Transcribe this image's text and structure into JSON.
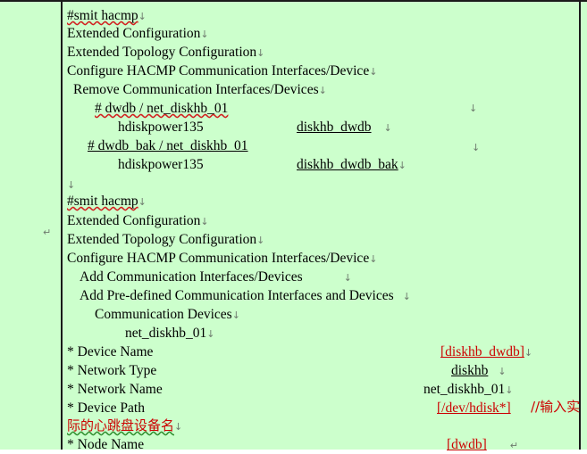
{
  "document": {
    "background_color": "#ccffcc",
    "text_color": "#000000",
    "accent_color": "#cc0000",
    "mark_color": "#6e7b6e",
    "spellcheck_underline_color": "#d21f1f",
    "grammar_underline_color": "#2f8f2f",
    "border_color": "#1a1a1a",
    "line_break_mark": "↓",
    "paragraph_mark": "↵"
  },
  "block_one": {
    "lines": [
      {
        "id": "l01",
        "text": "#smit hacmp",
        "mark": "↓"
      },
      {
        "id": "l02",
        "text": "Extended Configuration",
        "mark": "↓"
      },
      {
        "id": "l03",
        "text": "Extended Topology Configuration",
        "mark": "↓"
      },
      {
        "id": "l04",
        "text": "Configure HACMP Communication Interfaces/Device",
        "mark": "↓"
      },
      {
        "id": "l05",
        "text": "Remove Communication Interfaces/Devices",
        "mark": "↓"
      },
      {
        "id": "l06",
        "text": "# dwdb / net_diskhb_01",
        "mark": ""
      },
      {
        "id": "l07",
        "text": "hdiskpower135",
        "value": "diskhb_dwdb",
        "mark": "↓"
      },
      {
        "id": "l08",
        "text": "# dwdb_bak / net_diskhb_01",
        "mark": "↓"
      },
      {
        "id": "l09",
        "text": "hdiskpower135",
        "value": "diskhb_dwdb_bak",
        "mark": "↓"
      }
    ]
  },
  "block_two": {
    "lines": [
      {
        "id": "l11",
        "text": "#smit hacmp",
        "mark": "↓"
      },
      {
        "id": "l12",
        "text": "Extended Configuration",
        "mark": "↓"
      },
      {
        "id": "l13",
        "text": "Extended Topology Configuration",
        "mark": "↓"
      },
      {
        "id": "l14",
        "text": "Configure HACMP Communication Interfaces/Device",
        "mark": "↓"
      },
      {
        "id": "l15",
        "text": "Add Communication Interfaces/Devices",
        "mark": "↓"
      },
      {
        "id": "l16",
        "text": "Add Pre-defined Communication Interfaces and Devices",
        "mark": "↓"
      },
      {
        "id": "l17",
        "text": "Communication Devices",
        "mark": "↓"
      },
      {
        "id": "l18",
        "text": "net_diskhb_01",
        "mark": "↓"
      }
    ]
  },
  "fields": [
    {
      "id": "f1",
      "label": "* Device Name",
      "value": "[diskhb_dwdb]",
      "value_color": "red",
      "mark": "↓",
      "comment": ""
    },
    {
      "id": "f2",
      "label": "* Network Type",
      "value": "diskhb",
      "value_color": "black",
      "mark": "↓",
      "comment": ""
    },
    {
      "id": "f3",
      "label": "* Network Name",
      "value": "net_diskhb_01",
      "value_color": "black",
      "mark": "↓",
      "comment": ""
    },
    {
      "id": "f4",
      "label": "* Device Path",
      "value": "[/dev/hdisk*]",
      "value_color": "red",
      "mark": "",
      "comment": "//输入实"
    },
    {
      "id": "f5",
      "label": "* Node Name",
      "value": "[dwdb]",
      "value_color": "red",
      "mark": "↵",
      "comment": ""
    }
  ],
  "annotation": {
    "cjk_note": "际的心跳盘设备名",
    "cjk_note_mark": "↓"
  },
  "stray_marks": [
    {
      "id": "m1",
      "glyph": "↓"
    },
    {
      "id": "m2",
      "glyph": "↓"
    },
    {
      "id": "m3",
      "glyph": "↵"
    }
  ]
}
